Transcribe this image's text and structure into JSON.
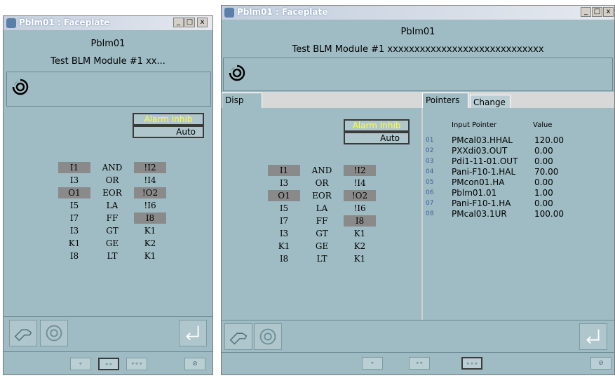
{
  "left": {
    "title": "Pblm01 : Faceplate",
    "controls": [
      "_",
      "□",
      "x"
    ],
    "name": "Pblm01",
    "description": "Test BLM Module #1 xx...",
    "alarm_inhibit": "Alarm Inhib",
    "mode": "Auto"
  },
  "right": {
    "title": "Pblm01 : Faceplate",
    "controls": [
      "_",
      "□",
      "x"
    ],
    "name": "Pblm01",
    "description": "Test BLM Module #1 xxxxxxxxxxxxxxxxxxxxxxxxxxxxx",
    "alarm_inhibit": "Alarm Inhib",
    "mode": "Auto",
    "tabs": {
      "disp": "Disp",
      "pointers": "Pointers",
      "change": "Change"
    },
    "pointer_headers": {
      "name": "Input Pointer",
      "value": "Value"
    },
    "pointers": [
      {
        "idx": "01",
        "name": "PMcal03.HHAL",
        "value": "120.00"
      },
      {
        "idx": "02",
        "name": "PXXdi03.OUT",
        "value": "0.00"
      },
      {
        "idx": "03",
        "name": "Pdi1-11-01.OUT",
        "value": "0.00"
      },
      {
        "idx": "04",
        "name": "Pani-F10-1.HAL",
        "value": "70.00"
      },
      {
        "idx": "05",
        "name": "PMcon01.HA",
        "value": "0.00"
      },
      {
        "idx": "06",
        "name": "Pblm01.01",
        "value": "1.00"
      },
      {
        "idx": "07",
        "name": "Pani-F10-1.HA",
        "value": "0.00"
      },
      {
        "idx": "08",
        "name": "PMcal03.1UR",
        "value": "100.00"
      }
    ]
  },
  "logic_grid": [
    [
      {
        "t": "I1",
        "hl": true
      },
      {
        "t": "AND",
        "hl": false
      },
      {
        "t": "!I2",
        "hl": true
      }
    ],
    [
      {
        "t": "I3",
        "hl": false
      },
      {
        "t": "OR",
        "hl": false
      },
      {
        "t": "!I4",
        "hl": false
      }
    ],
    [
      {
        "t": "O1",
        "hl": true
      },
      {
        "t": "EOR",
        "hl": false
      },
      {
        "t": "!O2",
        "hl": true
      }
    ],
    [
      {
        "t": "I5",
        "hl": false
      },
      {
        "t": "LA",
        "hl": false
      },
      {
        "t": "!I6",
        "hl": false
      }
    ],
    [
      {
        "t": "I7",
        "hl": false
      },
      {
        "t": "FF",
        "hl": false
      },
      {
        "t": "I8",
        "hl": true
      }
    ],
    [
      {
        "t": "I3",
        "hl": false
      },
      {
        "t": "GT",
        "hl": false
      },
      {
        "t": "K1",
        "hl": false
      }
    ],
    [
      {
        "t": "K1",
        "hl": false
      },
      {
        "t": "GE",
        "hl": false
      },
      {
        "t": "K2",
        "hl": false
      }
    ],
    [
      {
        "t": "I8",
        "hl": false
      },
      {
        "t": "LT",
        "hl": false
      },
      {
        "t": "K1",
        "hl": false
      }
    ]
  ],
  "nav_buttons": [
    "∘",
    "∘∘",
    "∘∘∘"
  ],
  "colors": {
    "window_bg": "#9fbcc4",
    "highlight": "#8a8a8a",
    "alarm_text": "#ffff3a"
  }
}
